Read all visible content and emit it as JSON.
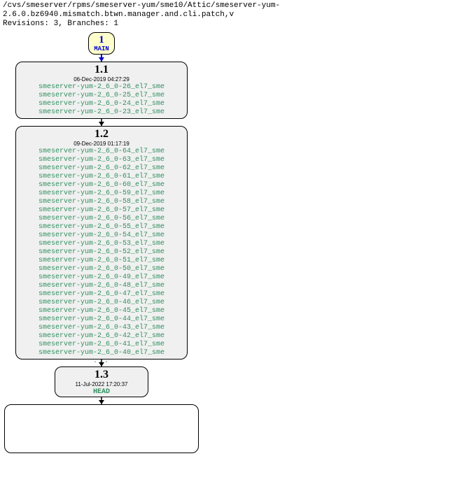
{
  "header": {
    "path": "/cvs/smeserver/rpms/smeserver-yum/sme10/Attic/smeserver-yum-2.6.0.bz6940.mismatch.btwn.manager.and.cli.patch,v",
    "meta": "Revisions: 3, Branches: 1"
  },
  "branch": {
    "num": "1",
    "name": "MAIN"
  },
  "rev1": {
    "title": "1.1",
    "date": "06-Dec-2019 04:27:29",
    "tags": [
      "smeserver-yum-2_6_0-26_el7_sme",
      "smeserver-yum-2_6_0-25_el7_sme",
      "smeserver-yum-2_6_0-24_el7_sme",
      "smeserver-yum-2_6_0-23_el7_sme"
    ]
  },
  "rev2": {
    "title": "1.2",
    "date": "09-Dec-2019 01:17:19",
    "tags": [
      "smeserver-yum-2_6_0-64_el7_sme",
      "smeserver-yum-2_6_0-63_el7_sme",
      "smeserver-yum-2_6_0-62_el7_sme",
      "smeserver-yum-2_6_0-61_el7_sme",
      "smeserver-yum-2_6_0-60_el7_sme",
      "smeserver-yum-2_6_0-59_el7_sme",
      "smeserver-yum-2_6_0-58_el7_sme",
      "smeserver-yum-2_6_0-57_el7_sme",
      "smeserver-yum-2_6_0-56_el7_sme",
      "smeserver-yum-2_6_0-55_el7_sme",
      "smeserver-yum-2_6_0-54_el7_sme",
      "smeserver-yum-2_6_0-53_el7_sme",
      "smeserver-yum-2_6_0-52_el7_sme",
      "smeserver-yum-2_6_0-51_el7_sme",
      "smeserver-yum-2_6_0-50_el7_sme",
      "smeserver-yum-2_6_0-49_el7_sme",
      "smeserver-yum-2_6_0-48_el7_sme",
      "smeserver-yum-2_6_0-47_el7_sme",
      "smeserver-yum-2_6_0-46_el7_sme",
      "smeserver-yum-2_6_0-45_el7_sme",
      "smeserver-yum-2_6_0-44_el7_sme",
      "smeserver-yum-2_6_0-43_el7_sme",
      "smeserver-yum-2_6_0-42_el7_sme",
      "smeserver-yum-2_6_0-41_el7_sme",
      "smeserver-yum-2_6_0-40_el7_sme"
    ],
    "ellipsis": "..."
  },
  "rev3": {
    "title": "1.3",
    "date": "11-Jul-2022 17:20:37",
    "head": "HEAD"
  }
}
